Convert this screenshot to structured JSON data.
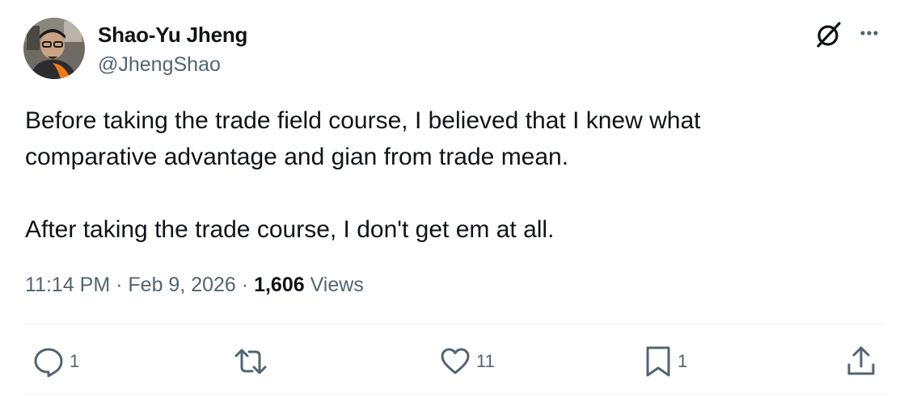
{
  "author": {
    "display_name": "Shao-Yu Jheng",
    "handle": "@JhengShao",
    "avatar_icon": "profile-photo"
  },
  "header_icons": [
    "grok-icon",
    "more-options-icon"
  ],
  "tweet": {
    "paragraphs": [
      "Before taking the trade field course, I believed that I knew what",
      "comparative advantage and gian from trade mean.",
      "After taking the trade course, I don't get em at all."
    ],
    "time": "11:14 PM",
    "separator": "·",
    "date": "Feb 9, 2026",
    "views_count": "1,606",
    "views_label": "Views"
  },
  "actions": {
    "reply": {
      "icon": "reply-icon",
      "count": "1"
    },
    "retweet": {
      "icon": "retweet-icon",
      "count": ""
    },
    "like": {
      "icon": "heart-icon",
      "count": "11"
    },
    "bookmark": {
      "icon": "bookmark-icon",
      "count": "1"
    },
    "share": {
      "icon": "share-icon",
      "count": ""
    }
  },
  "colors": {
    "text_primary": "#0f1419",
    "text_secondary": "#536471",
    "divider": "#eff3f4"
  }
}
